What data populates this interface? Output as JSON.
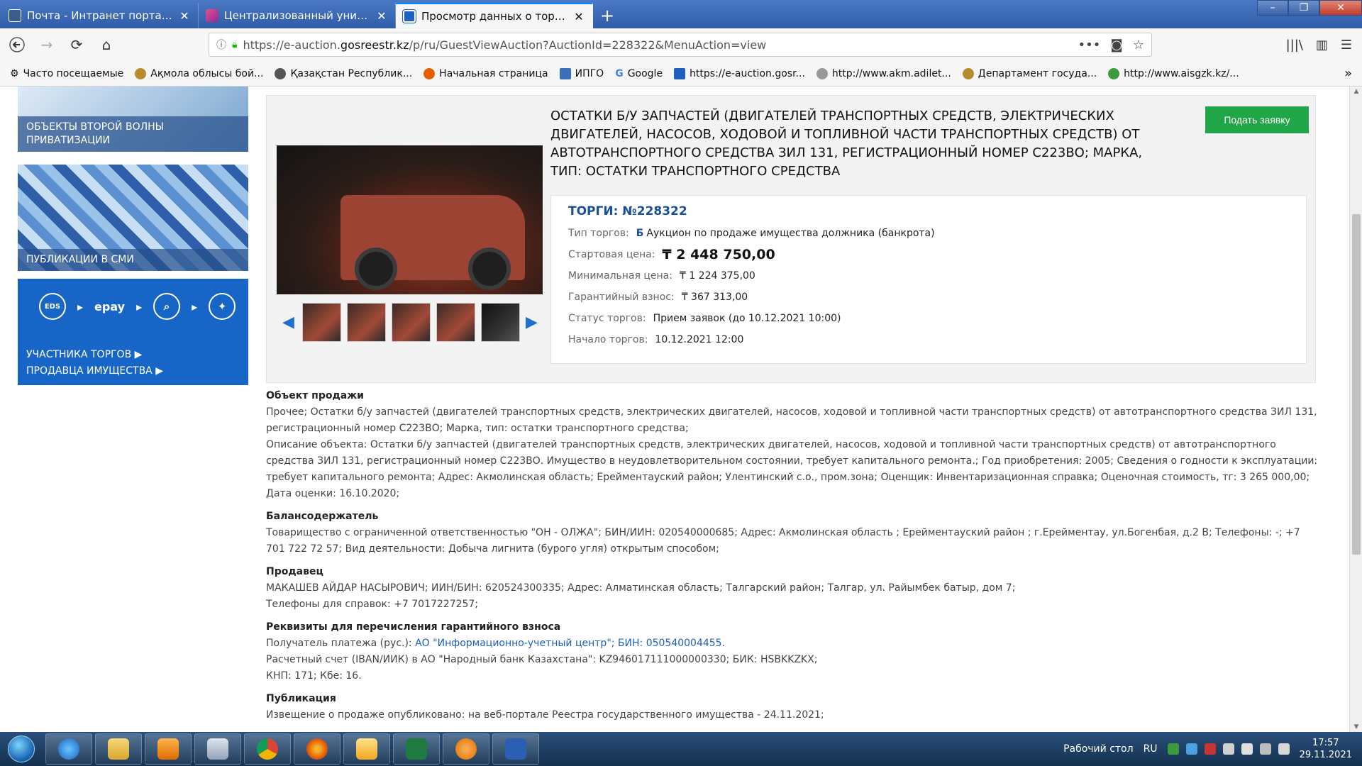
{
  "browser": {
    "tabs": [
      {
        "title": "Почта - Интранет портал гос",
        "active": false
      },
      {
        "title": "Централизованный унифици",
        "active": false
      },
      {
        "title": "Просмотр данных о торгах",
        "active": true
      }
    ],
    "url_prefix": "https://e-auction.",
    "url_domain": "gosreestr.kz",
    "url_rest": "/p/ru/GuestViewAuction?AuctionId=228322&MenuAction=view",
    "bookmarks": [
      "Часто посещаемые",
      "Ақмола облысы бой...",
      "Қазақстан Республик...",
      "Начальная страница",
      "ИПГО",
      "Google",
      "https://e-auction.gosr...",
      "http://www.akm.adilet...",
      "Департамент госуда...",
      "http://www.aisgzk.kz/..."
    ]
  },
  "sidebar": {
    "banner1": "ОБЪЕКТЫ ВТОРОЙ ВОЛНЫ ПРИВАТИЗАЦИИ",
    "banner2": "ПУБЛИКАЦИИ В СМИ",
    "banner3_icon_text": "epay",
    "banner3_eds": "EDS",
    "banner3_link1": "УЧАСТНИКА ТОРГОВ ▶",
    "banner3_link2": "ПРОДАВЦА ИМУЩЕСТВА ▶"
  },
  "auction": {
    "title": "ОСТАТКИ Б/У ЗАПЧАСТЕЙ (ДВИГАТЕЛЕЙ ТРАНСПОРТНЫХ СРЕДСТВ, ЭЛЕКТРИЧЕСКИХ ДВИГАТЕЛЕЙ, НАСОСОВ, ХОДОВОЙ И ТОПЛИВНОЙ ЧАСТИ ТРАНСПОРТНЫХ СРЕДСТВ) ОТ АВТОТРАНСПОРТНОГО СРЕДСТВА ЗИЛ 131, РЕГИСТРАЦИОННЫЙ НОМЕР С223ВО; МАРКА, ТИП: ОСТАТКИ ТРАНСПОРТНОГО СРЕДСТВА",
    "submit_label": "Подать заявку",
    "lot": "ТОРГИ: №228322",
    "type_label": "Тип торгов:",
    "type_tag": "Б",
    "type_value": "Аукцион по продаже имущества должника (банкрота)",
    "start_price_label": "Стартовая цена:",
    "start_price": "₸ 2 448 750,00",
    "min_price_label": "Минимальная цена:",
    "min_price": "₸ 1 224 375,00",
    "deposit_label": "Гарантийный взнос:",
    "deposit": "₸ 367 313,00",
    "status_label": "Статус торгов:",
    "status": "Прием заявок (до 10.12.2021 10:00)",
    "start_label": "Начало торгов:",
    "start": "10.12.2021 12:00"
  },
  "sections": {
    "object_title": "Объект продажи",
    "object_p1": "Прочее; Остатки б/у запчастей (двигателей транспортных средств, электрических двигателей, насосов, ходовой и топливной части транспортных средств) от автотранспортного средства ЗИЛ 131, регистрационный номер С223ВО; Марка, тип: остатки транспортного средства;",
    "object_p2": "Описание объекта: Остатки б/у запчастей (двигателей транспортных средств, электрических двигателей, насосов, ходовой и топливной части транспортных средств) от автотранспортного средства ЗИЛ 131, регистрационный номер С223ВО. Имущество в неудовлетворительном состоянии, требует капитального ремонта.; Год приобретения: 2005; Сведения о годности к эксплуатации: требует капитального ремонта; Адрес: Акмолинская область; Ерейментауский район; Улентинский с.о., пром.зона; Оценщик: Инвентаризационная справка; Оценочная стоимость, тг: 3 265 000,00; Дата оценки: 16.10.2020;",
    "holder_title": "Балансодержатель",
    "holder_text": "Товарищество с ограниченной ответственностью \"ОН - ОЛЖА\"; БИН/ИИН: 020540000685; Адрес: Акмолинская область ; Ерейментауский район ; г.Ерейментау, ул.Богенбая, д.2 В; Телефоны: -; +7 701 722 72 57; Вид деятельности: Добыча лигнита (бурого угля) открытым способом;",
    "seller_title": "Продавец",
    "seller_text": "МАКАШЕВ АЙДАР НАСЫРОВИЧ; ИИН/БИН: 620524300335;  Адрес: Алматинская область; Талгарский район; Талгар, ул. Райымбек батыр, дом 7;",
    "seller_phone": "Телефоны для справок: +7 7017227257;",
    "req_title": "Реквизиты для перечисления гарантийного взноса",
    "req_prefix": "Получатель платежа (рус.): ",
    "req_link": "АО \"Информационно-учетный центр\"; БИН: 050540004455",
    "req_suffix": ".",
    "req_account": "Расчетный счет (IBAN/ИИК) в АО \"Народный банк Казахстана\": KZ946017111000000330; БИК: HSBKKZKX;",
    "req_knp": "КНП: 171; Кбе: 16.",
    "pub_title": "Публикация",
    "pub_text": "Извещение о продаже опубликовано: на веб-портале Реестра государственного имущества - 24.11.2021;"
  },
  "taskbar": {
    "desktop_label": "Рабочий стол",
    "lang": "RU",
    "time": "17:57",
    "date": "29.11.2021"
  },
  "colors": {
    "accent": "#1a4f9c",
    "submit": "#20a548",
    "banner_blue": "#1766c7"
  }
}
